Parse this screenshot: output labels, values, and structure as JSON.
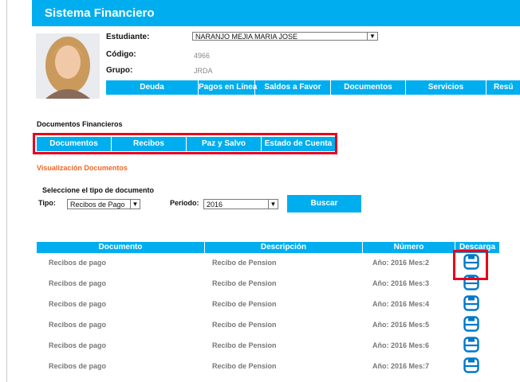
{
  "app_title": "Sistema Financiero",
  "student": {
    "label_estudiante": "Estudiante:",
    "label_codigo": "Código:",
    "label_grupo": "Grupo:",
    "name": "NARANJO MEJIA MARIA JOSE",
    "codigo": "4966",
    "grupo": "JRDA"
  },
  "nav": {
    "tabs": [
      "Deuda",
      "Pagos en Línea",
      "Saldos a Favor",
      "Documentos",
      "Servicios",
      "Resú"
    ]
  },
  "section_title": "Documentos Financieros",
  "doc_tabs": [
    "Documentos",
    "Recibos",
    "Paz y Salvo",
    "Estado de Cuenta"
  ],
  "viz_title": "Visualización Documentos",
  "form": {
    "select_label": "Seleccione el tipo de documento",
    "tipo_label": "Tipo:",
    "tipo_value": "Recibos de Pago",
    "periodo_label": "Periodo:",
    "periodo_value": "2016",
    "buscar_label": "Buscar"
  },
  "table": {
    "headers": [
      "Documento",
      "Descripción",
      "Número",
      "Descarga"
    ],
    "rows": [
      {
        "documento": "Recibos de pago",
        "descripcion": "Recibo de Pension",
        "numero": "Año: 2016 Mes:2"
      },
      {
        "documento": "Recibos de pago",
        "descripcion": "Recibo de Pension",
        "numero": "Año: 2016 Mes:3"
      },
      {
        "documento": "Recibos de pago",
        "descripcion": "Recibo de Pension",
        "numero": "Año: 2016 Mes:4"
      },
      {
        "documento": "Recibos de pago",
        "descripcion": "Recibo de Pension",
        "numero": "Año: 2016 Mes:5"
      },
      {
        "documento": "Recibos de pago",
        "descripcion": "Recibo de Pension",
        "numero": "Año: 2016 Mes:6"
      },
      {
        "documento": "Recibos de pago",
        "descripcion": "Recibo de Pension",
        "numero": "Año: 2016 Mes:7"
      }
    ]
  },
  "colors": {
    "accent": "#00aeef",
    "highlight": "#e8001c",
    "orange": "#f26522"
  },
  "icons": {
    "download": "download-icon"
  }
}
